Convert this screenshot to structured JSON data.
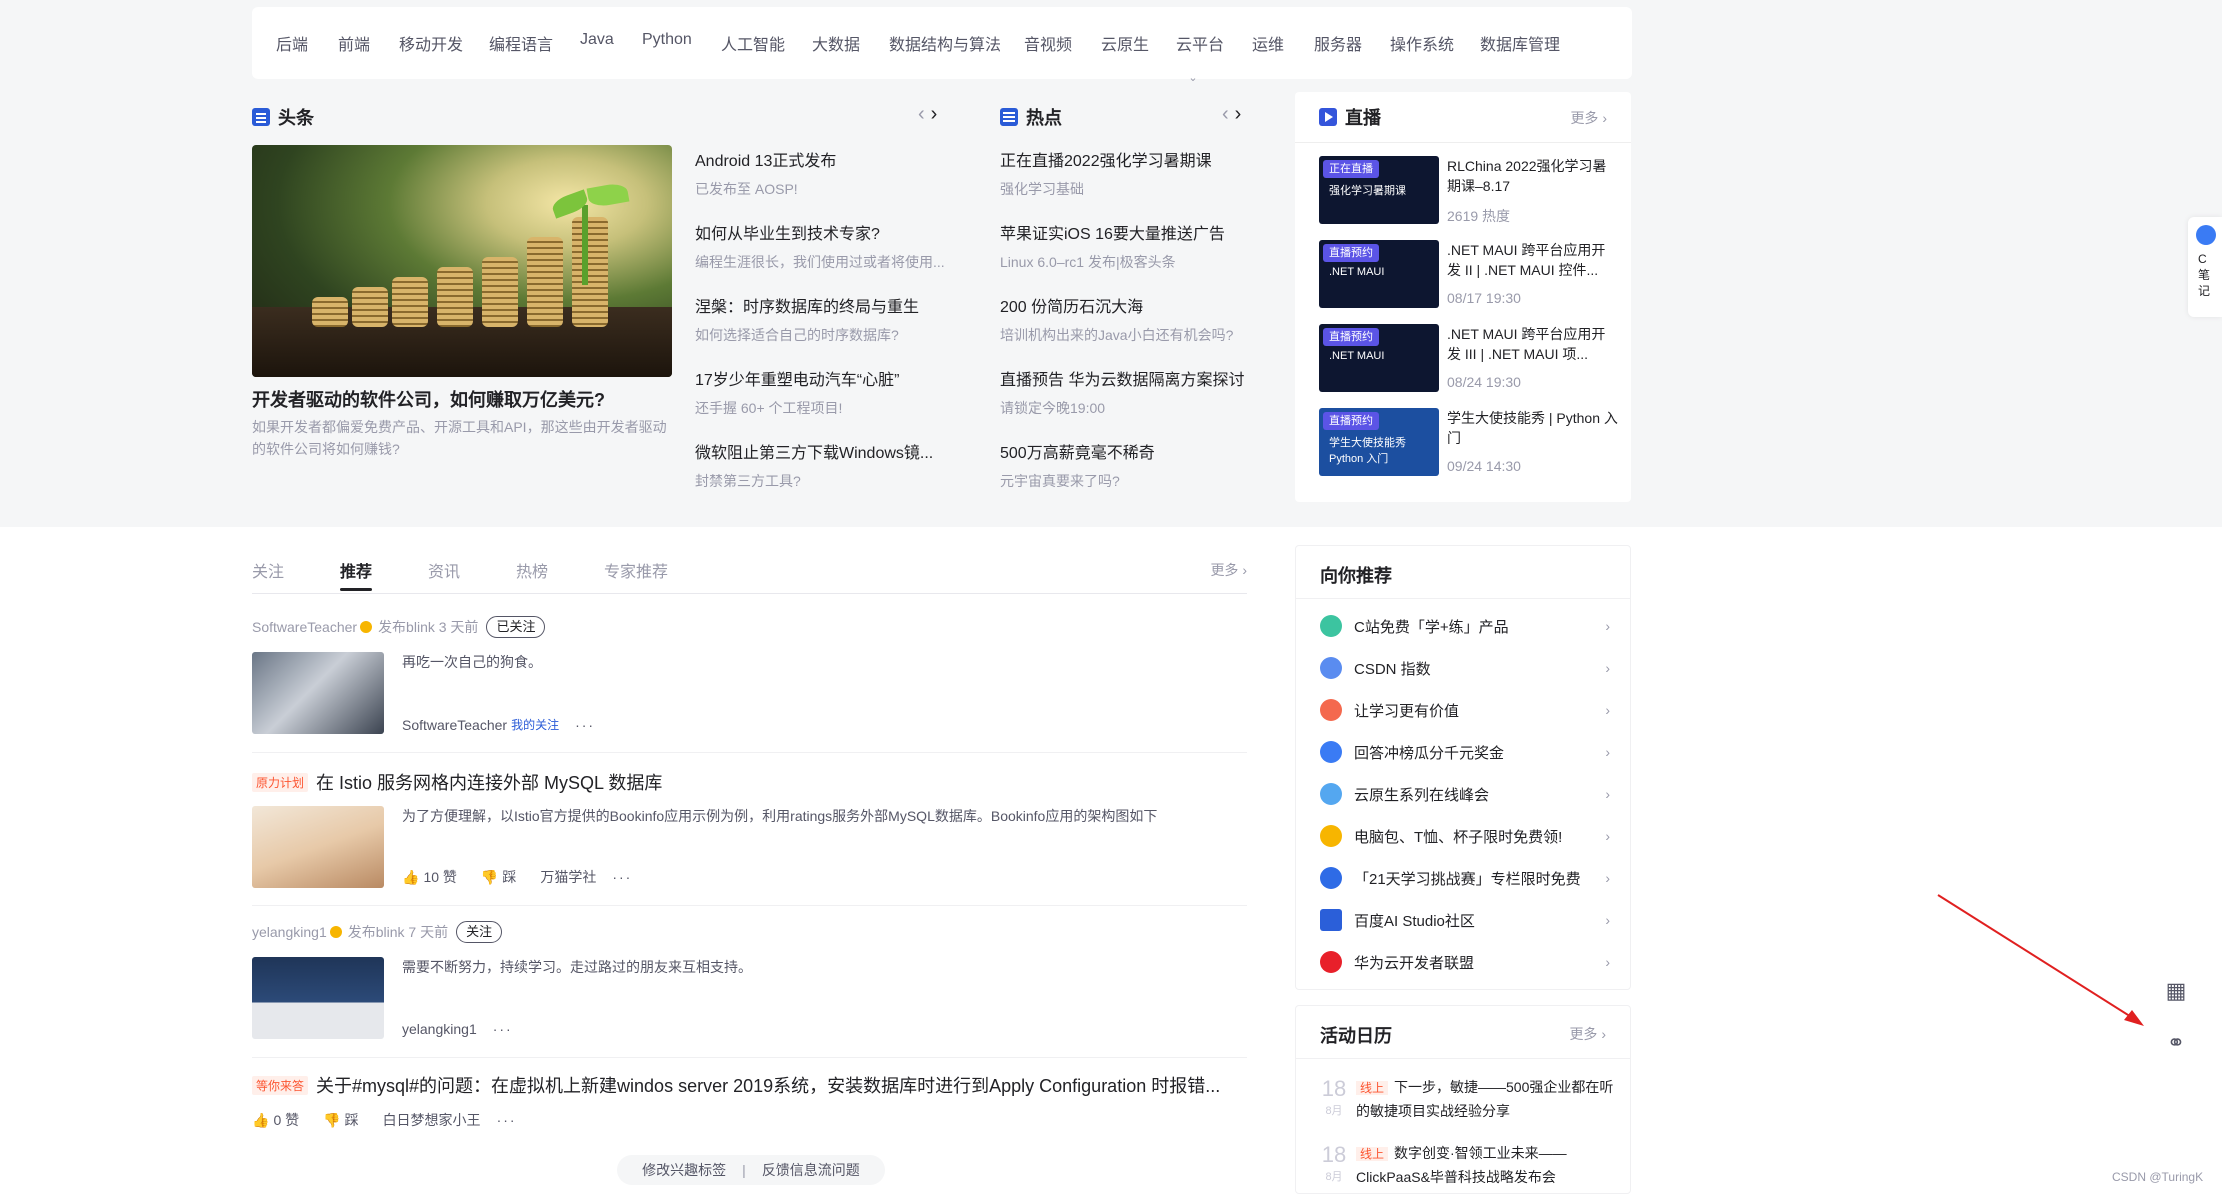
{
  "categories": [
    "后端",
    "前端",
    "移动开发",
    "编程语言",
    "Java",
    "Python",
    "人工智能",
    "大数据",
    "数据结构与算法",
    "音视频",
    "云原生",
    "云平台",
    "运维",
    "服务器",
    "操作系统",
    "数据库管理"
  ],
  "headline": {
    "section_title": "头条",
    "main_title": "开发者驱动的软件公司，如何赚取万亿美元?",
    "main_desc": "如果开发者都偏爱免费产品、开源工具和API，那这些由开发者驱动的软件公司将如何赚钱?",
    "items": [
      {
        "title": "Android 13正式发布",
        "desc": "已发布至 AOSP!"
      },
      {
        "title": "如何从毕业生到技术专家?",
        "desc": "编程生涯很长，我们使用过或者将使用..."
      },
      {
        "title": "涅槃：时序数据库的终局与重生",
        "desc": "如何选择适合自己的时序数据库?"
      },
      {
        "title": "17岁少年重塑电动汽车“心脏”",
        "desc": "还手握 60+ 个工程项目!"
      },
      {
        "title": "微软阻止第三方下载Windows镜...",
        "desc": "封禁第三方工具?"
      }
    ]
  },
  "hot": {
    "section_title": "热点",
    "items": [
      {
        "title": "正在直播2022强化学习暑期课",
        "desc": "强化学习基础"
      },
      {
        "title": "苹果证实iOS 16要大量推送广告",
        "desc": "Linux 6.0–rc1 发布|极客头条"
      },
      {
        "title": "200 份简历石沉大海",
        "desc": "培训机构出来的Java小白还有机会吗?"
      },
      {
        "title": "直播预告 华为云数据隔离方案探讨",
        "desc": "请锁定今晚19:00"
      },
      {
        "title": "500万高薪竟毫不稀奇",
        "desc": "元宇宙真要来了吗?"
      }
    ]
  },
  "live": {
    "section_title": "直播",
    "more": "更多",
    "items": [
      {
        "tag": "正在直播",
        "cap": "强化学习暑期课",
        "title": "RLChina 2022强化学习暑期课–8.17",
        "meta": "2619 热度"
      },
      {
        "tag": "直播预约",
        "cap": ".NET MAUI",
        "title": ".NET MAUI 跨平台应用开发 II | .NET MAUI 控件...",
        "meta": "08/17 19:30"
      },
      {
        "tag": "直播预约",
        "cap": ".NET MAUI",
        "title": ".NET MAUI 跨平台应用开发 III | .NET MAUI 项...",
        "meta": "08/24 19:30"
      },
      {
        "tag": "直播预约",
        "cap": "学生大使技能秀 Python 入门",
        "title": "学生大使技能秀 | Python 入门",
        "meta": "09/24 14:30"
      }
    ]
  },
  "feed": {
    "tabs": [
      "关注",
      "推荐",
      "资讯",
      "热榜",
      "专家推荐"
    ],
    "active_tab": 1,
    "more": "更多",
    "items": [
      {
        "author": "SoftwareTeacher",
        "action": "发布blink",
        "time": "3 天前",
        "follow": "已关注",
        "text": "再吃一次自己的狗食。",
        "foot_author": "SoftwareTeacher",
        "foot_mine": "我的关注"
      },
      {
        "badge": "原力计划",
        "title": "在 Istio 服务网格内连接外部 MySQL 数据库",
        "text": "为了方便理解，以Istio官方提供的Bookinfo应用示例为例，利用ratings服务外部MySQL数据库。Bookinfo应用的架构图如下",
        "likes": "10 赞",
        "dislike": "踩",
        "author": "万猫学社"
      },
      {
        "author": "yelangking1",
        "action": "发布blink",
        "time": "7 天前",
        "follow": "关注",
        "text": "需要不断努力，持续学习。走过路过的朋友来互相支持。",
        "foot_author": "yelangking1"
      },
      {
        "badge": "等你来答",
        "title": "关于#mysql#的问题：在虚拟机上新建windos server 2019系统，安装数据库时进行到Apply Configuration 时报错...",
        "likes": "0 赞",
        "dislike": "踩",
        "author": "白日梦想家小王"
      }
    ]
  },
  "bottom_links": [
    "修改兴趣标签",
    "反馈信息流问题"
  ],
  "recommend": {
    "title": "向你推荐",
    "items": [
      {
        "label": "C站免费「学+练」产品",
        "color": "#3cc4a0"
      },
      {
        "label": "CSDN 指数",
        "color": "#5a8cf0"
      },
      {
        "label": "让学习更有价值",
        "color": "#f4694e"
      },
      {
        "label": "回答冲榜瓜分千元奖金",
        "color": "#3a7bf4"
      },
      {
        "label": "云原生系列在线峰会",
        "color": "#54a7f0"
      },
      {
        "label": "电脑包、T恤、杯子限时免费领!",
        "color": "#f7b500"
      },
      {
        "label": "「21天学习挑战赛」专栏限时免费",
        "color": "#2e6be6"
      },
      {
        "label": "百度AI Studio社区",
        "color": "#2b5fd9"
      },
      {
        "label": "华为云开发者联盟",
        "color": "#e8202a"
      }
    ]
  },
  "calendar": {
    "title": "活动日历",
    "more": "更多",
    "items": [
      {
        "day": "18",
        "month": "8月",
        "tag": "线上",
        "text": "下一步，敏捷——500强企业都在听的敏捷项目实战经验分享"
      },
      {
        "day": "18",
        "month": "8月",
        "tag": "线上",
        "text": "数字创变·智领工业未来——ClickPaaS&毕普科技战略发布会"
      }
    ]
  },
  "note_widget": "C笔记",
  "watermark": "CSDN @TuringK",
  "colors": {
    "accent": "#fc5531",
    "link": "#2a5bd7",
    "arrow": "#e02020"
  }
}
